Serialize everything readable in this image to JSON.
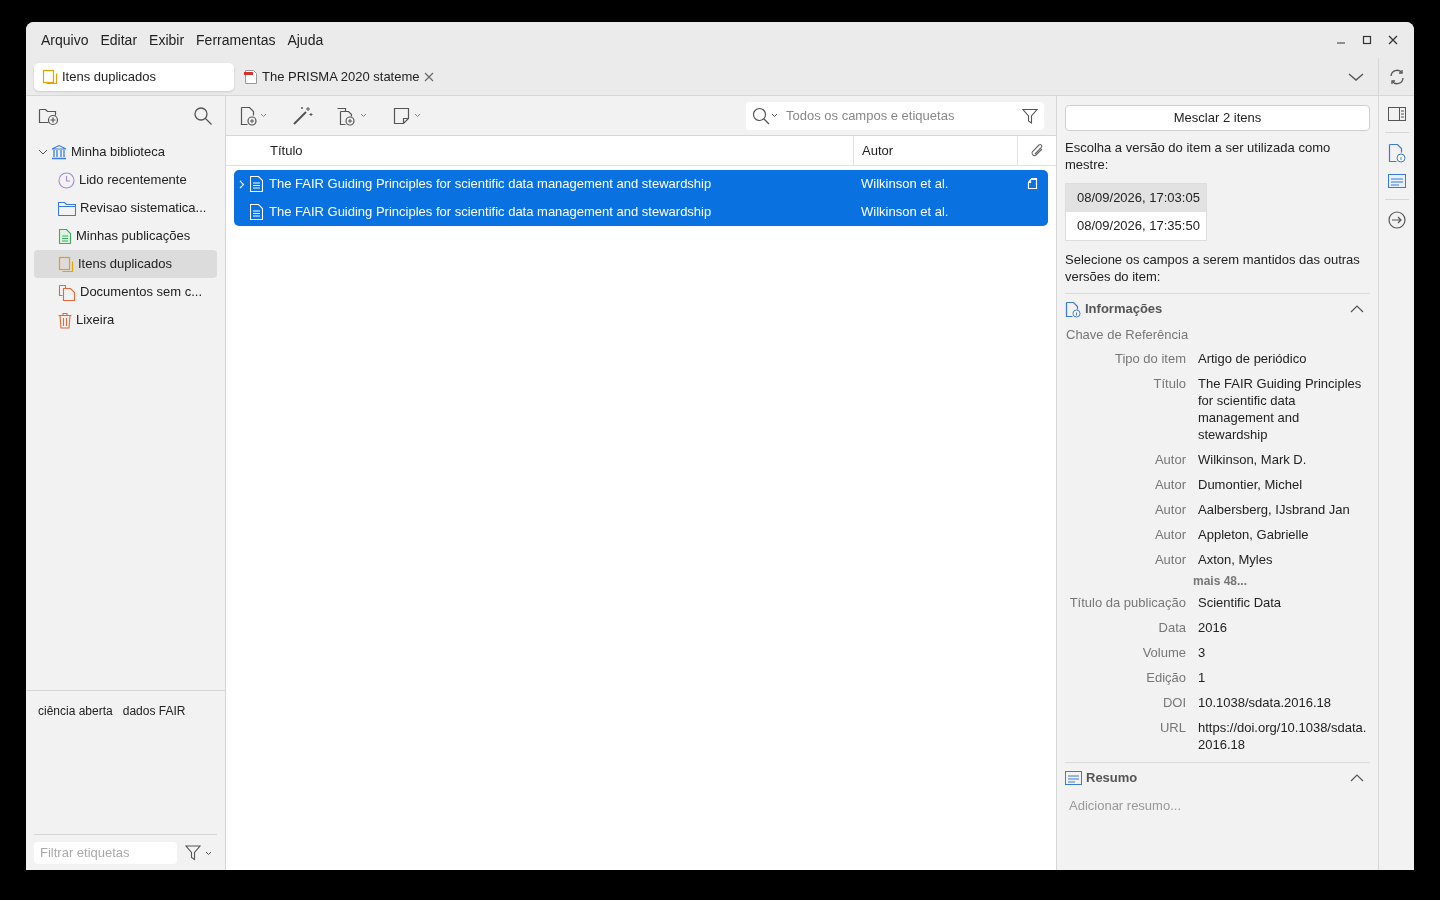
{
  "menu": [
    "Arquivo",
    "Editar",
    "Exibir",
    "Ferramentas",
    "Ajuda"
  ],
  "tabs": [
    {
      "label": "Itens duplicados",
      "kind": "library",
      "selected": true
    },
    {
      "label": "The PRISMA 2020 stateme",
      "kind": "pdf",
      "selected": false
    }
  ],
  "collections": [
    {
      "label": "Minha biblioteca",
      "kind": "library",
      "selected": false,
      "expanded": true,
      "children": [
        {
          "label": "Lido recentemente",
          "kind": "recent",
          "selected": false
        },
        {
          "label": "Revisao sistematica...",
          "kind": "folder",
          "selected": false
        },
        {
          "label": "Minhas publicações",
          "kind": "publications",
          "selected": false
        },
        {
          "label": "Itens duplicados",
          "kind": "duplicates",
          "selected": true
        },
        {
          "label": "Documentos sem c...",
          "kind": "unfiled",
          "selected": false
        },
        {
          "label": "Lixeira",
          "kind": "trash",
          "selected": false
        }
      ]
    }
  ],
  "tags": [
    "ciência aberta",
    "dados FAIR"
  ],
  "tag_filter": {
    "placeholder": "Filtrar etiquetas"
  },
  "search": {
    "placeholder": "Todos os campos e etiquetas"
  },
  "columns": [
    "Título",
    "Autor"
  ],
  "rows": [
    {
      "title": "The FAIR Guiding Principles for scientific data management and stewardship",
      "author": "Wilkinson et al.",
      "selected": true,
      "has_children": true,
      "attachment": true
    },
    {
      "title": "The FAIR Guiding Principles for scientific data management and stewardship",
      "author": "Wilkinson et al.",
      "selected": true,
      "has_children": false,
      "attachment": false
    }
  ],
  "merge": {
    "button": "Mesclar 2 itens",
    "instruction": "Escolha a versão do item a ser utilizada como mestre:",
    "versions": [
      {
        "label": "08/09/2026, 17:03:05",
        "selected": true
      },
      {
        "label": "08/09/2026, 17:35:50",
        "selected": false
      }
    ],
    "fields_instruction": "Selecione os campos a serem mantidos das outras versões do item:"
  },
  "info": {
    "title": "Informações",
    "expanded": true,
    "key_label": "Chave de Referência",
    "fields": [
      {
        "kind": "field",
        "label": "Tipo do item",
        "value": "Artigo de periódico"
      },
      {
        "kind": "field",
        "label": "Título",
        "value": "The FAIR Guiding Principles for scientific data management and stewardship"
      },
      {
        "kind": "field",
        "label": "Autor",
        "value": "Wilkinson, Mark D."
      },
      {
        "kind": "field",
        "label": "Autor",
        "value": "Dumontier, Michel"
      },
      {
        "kind": "field",
        "label": "Autor",
        "value": "Aalbersberg, IJsbrand Jan"
      },
      {
        "kind": "field",
        "label": "Autor",
        "value": "Appleton, Gabrielle"
      },
      {
        "kind": "field",
        "label": "Autor",
        "value": "Axton, Myles"
      },
      {
        "kind": "more",
        "value": "mais 48..."
      },
      {
        "kind": "field",
        "label": "Título da publicação",
        "value": "Scientific Data"
      },
      {
        "kind": "field",
        "label": "Data",
        "value": "2016"
      },
      {
        "kind": "field",
        "label": "Volume",
        "value": "3"
      },
      {
        "kind": "field",
        "label": "Edição",
        "value": "1"
      },
      {
        "kind": "field",
        "label": "DOI",
        "value": "10.1038/sdata.2016.18"
      },
      {
        "kind": "field",
        "label": "URL",
        "value": "https://doi.org/10.1038/sdata.2016.18"
      }
    ]
  },
  "abstract": {
    "title": "Resumo",
    "expanded": true,
    "placeholder": "Adicionar resumo..."
  }
}
